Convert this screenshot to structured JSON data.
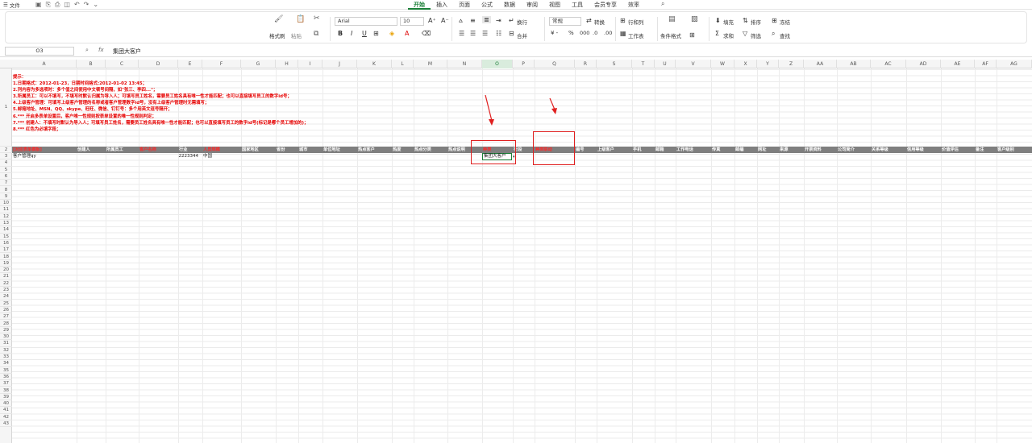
{
  "menubar": {
    "file_label": "文件",
    "tabs": [
      "开始",
      "插入",
      "页面",
      "公式",
      "数据",
      "审阅",
      "视图",
      "工具",
      "会员专享",
      "效率"
    ],
    "active_tab": "开始"
  },
  "ribbon": {
    "format_painter": "格式刷",
    "paste": "粘贴",
    "font_name": "Arial",
    "font_size": "10",
    "wrap_text": "换行",
    "merge": "合并",
    "number_format": "常规",
    "convert": "转换",
    "rows_cols": "行和列",
    "worksheet": "工作表",
    "conditional_format": "条件格式",
    "fill": "填充",
    "sort": "排序",
    "freeze": "冻结",
    "sum": "求和",
    "filter": "筛选",
    "find": "查找"
  },
  "formula_bar": {
    "cell_ref": "O3",
    "fx": "fx",
    "value": "集团大客户"
  },
  "columns": [
    "A",
    "B",
    "C",
    "D",
    "E",
    "F",
    "G",
    "H",
    "I",
    "J",
    "K",
    "L",
    "M",
    "N",
    "O",
    "P",
    "Q",
    "R",
    "S",
    "T",
    "U",
    "V",
    "W",
    "X",
    "Y",
    "Z",
    "AA",
    "AB",
    "AC",
    "AD",
    "AE",
    "AF",
    "AG"
  ],
  "rows": [
    "1",
    "2",
    "3",
    "4",
    "5",
    "6",
    "7",
    "8",
    "9",
    "10",
    "11",
    "12",
    "13",
    "14",
    "15",
    "16",
    "17",
    "18",
    "19",
    "20",
    "21",
    "22",
    "23",
    "24",
    "25",
    "26",
    "27",
    "28",
    "29",
    "30",
    "31",
    "32",
    "33",
    "34",
    "35",
    "36",
    "37",
    "38",
    "39",
    "40",
    "41",
    "42",
    "43"
  ],
  "notes": {
    "l0": "提示：",
    "l1": "1.日期格式：2012-01-23，日期时间格式:2012-01-02 13:45；",
    "l2": "2.列内容为多选项时：多个值之间使用中文顿号间隔，如\"张三、李四...\"；",
    "l3": "3.所属员工：可以不填写，不填写时默认归属为导入人；可填写员工姓名，需要员工姓名具有唯一性才能匹配；也可以直接填写员工的数字id号；",
    "l4": "4.上级客户管理：可填写上级客户管理的名称或者客户管理数字id号，没有上级客户管理时无需填写；",
    "l5": "5.邮箱地址、MSN、QQ、skype、旺旺、微信、钉钉号：多个用英文逗号隔开；",
    "l6": "6.*** 开启多表单设置后，客户唯一性规则按表单设置的唯一性规则判定；",
    "l7": "7.*** 创建人：不填写时默认为导入人；可填写员工姓名，需要员工姓名具有唯一性才能匹配；也可以直接填写员工的数字id号(标记是哪个员工增加的)；",
    "l8": "8.*** 红色为必填字段；"
  },
  "headers": [
    {
      "label": "[对应表单模板]",
      "red": true
    },
    {
      "label": "创建人",
      "red": false
    },
    {
      "label": "所属员工",
      "red": false
    },
    {
      "label": "客户名称",
      "red": true
    },
    {
      "label": "行业",
      "red": false
    },
    {
      "label": "人员规模",
      "red": true
    },
    {
      "label": "国家地区",
      "red": false
    },
    {
      "label": "省份",
      "red": false
    },
    {
      "label": "城市",
      "red": false
    },
    {
      "label": "单位地址",
      "red": false
    },
    {
      "label": "热点客户",
      "red": false
    },
    {
      "label": "热度",
      "red": false
    },
    {
      "label": "热点分类",
      "red": false
    },
    {
      "label": "热点说明",
      "red": false
    },
    {
      "label": "种类",
      "red": true
    },
    {
      "label": "行段",
      "red": false
    },
    {
      "label": "种类联动",
      "red": true
    },
    {
      "label": "编号",
      "red": false
    },
    {
      "label": "上级客户",
      "red": false
    },
    {
      "label": "手机",
      "red": false
    },
    {
      "label": "邮箱",
      "red": false
    },
    {
      "label": "工作电话",
      "red": false
    },
    {
      "label": "传真",
      "red": false
    },
    {
      "label": "邮编",
      "red": false
    },
    {
      "label": "网址",
      "red": false
    },
    {
      "label": "来源",
      "red": false
    },
    {
      "label": "开票资料",
      "red": false
    },
    {
      "label": "公司简介",
      "red": false
    },
    {
      "label": "关系等级",
      "red": false
    },
    {
      "label": "信用等级",
      "red": false
    },
    {
      "label": "价值评估",
      "red": false
    },
    {
      "label": "备注",
      "red": false
    },
    {
      "label": "客户级别",
      "red": false
    }
  ],
  "data_row": {
    "a": "客户管理qy",
    "d": "2223344",
    "f": "中国",
    "o": "集团大客户"
  },
  "colors": {
    "accent": "#1a7f37",
    "annotation": "#e02020",
    "header_bg": "#7f7f7f"
  }
}
